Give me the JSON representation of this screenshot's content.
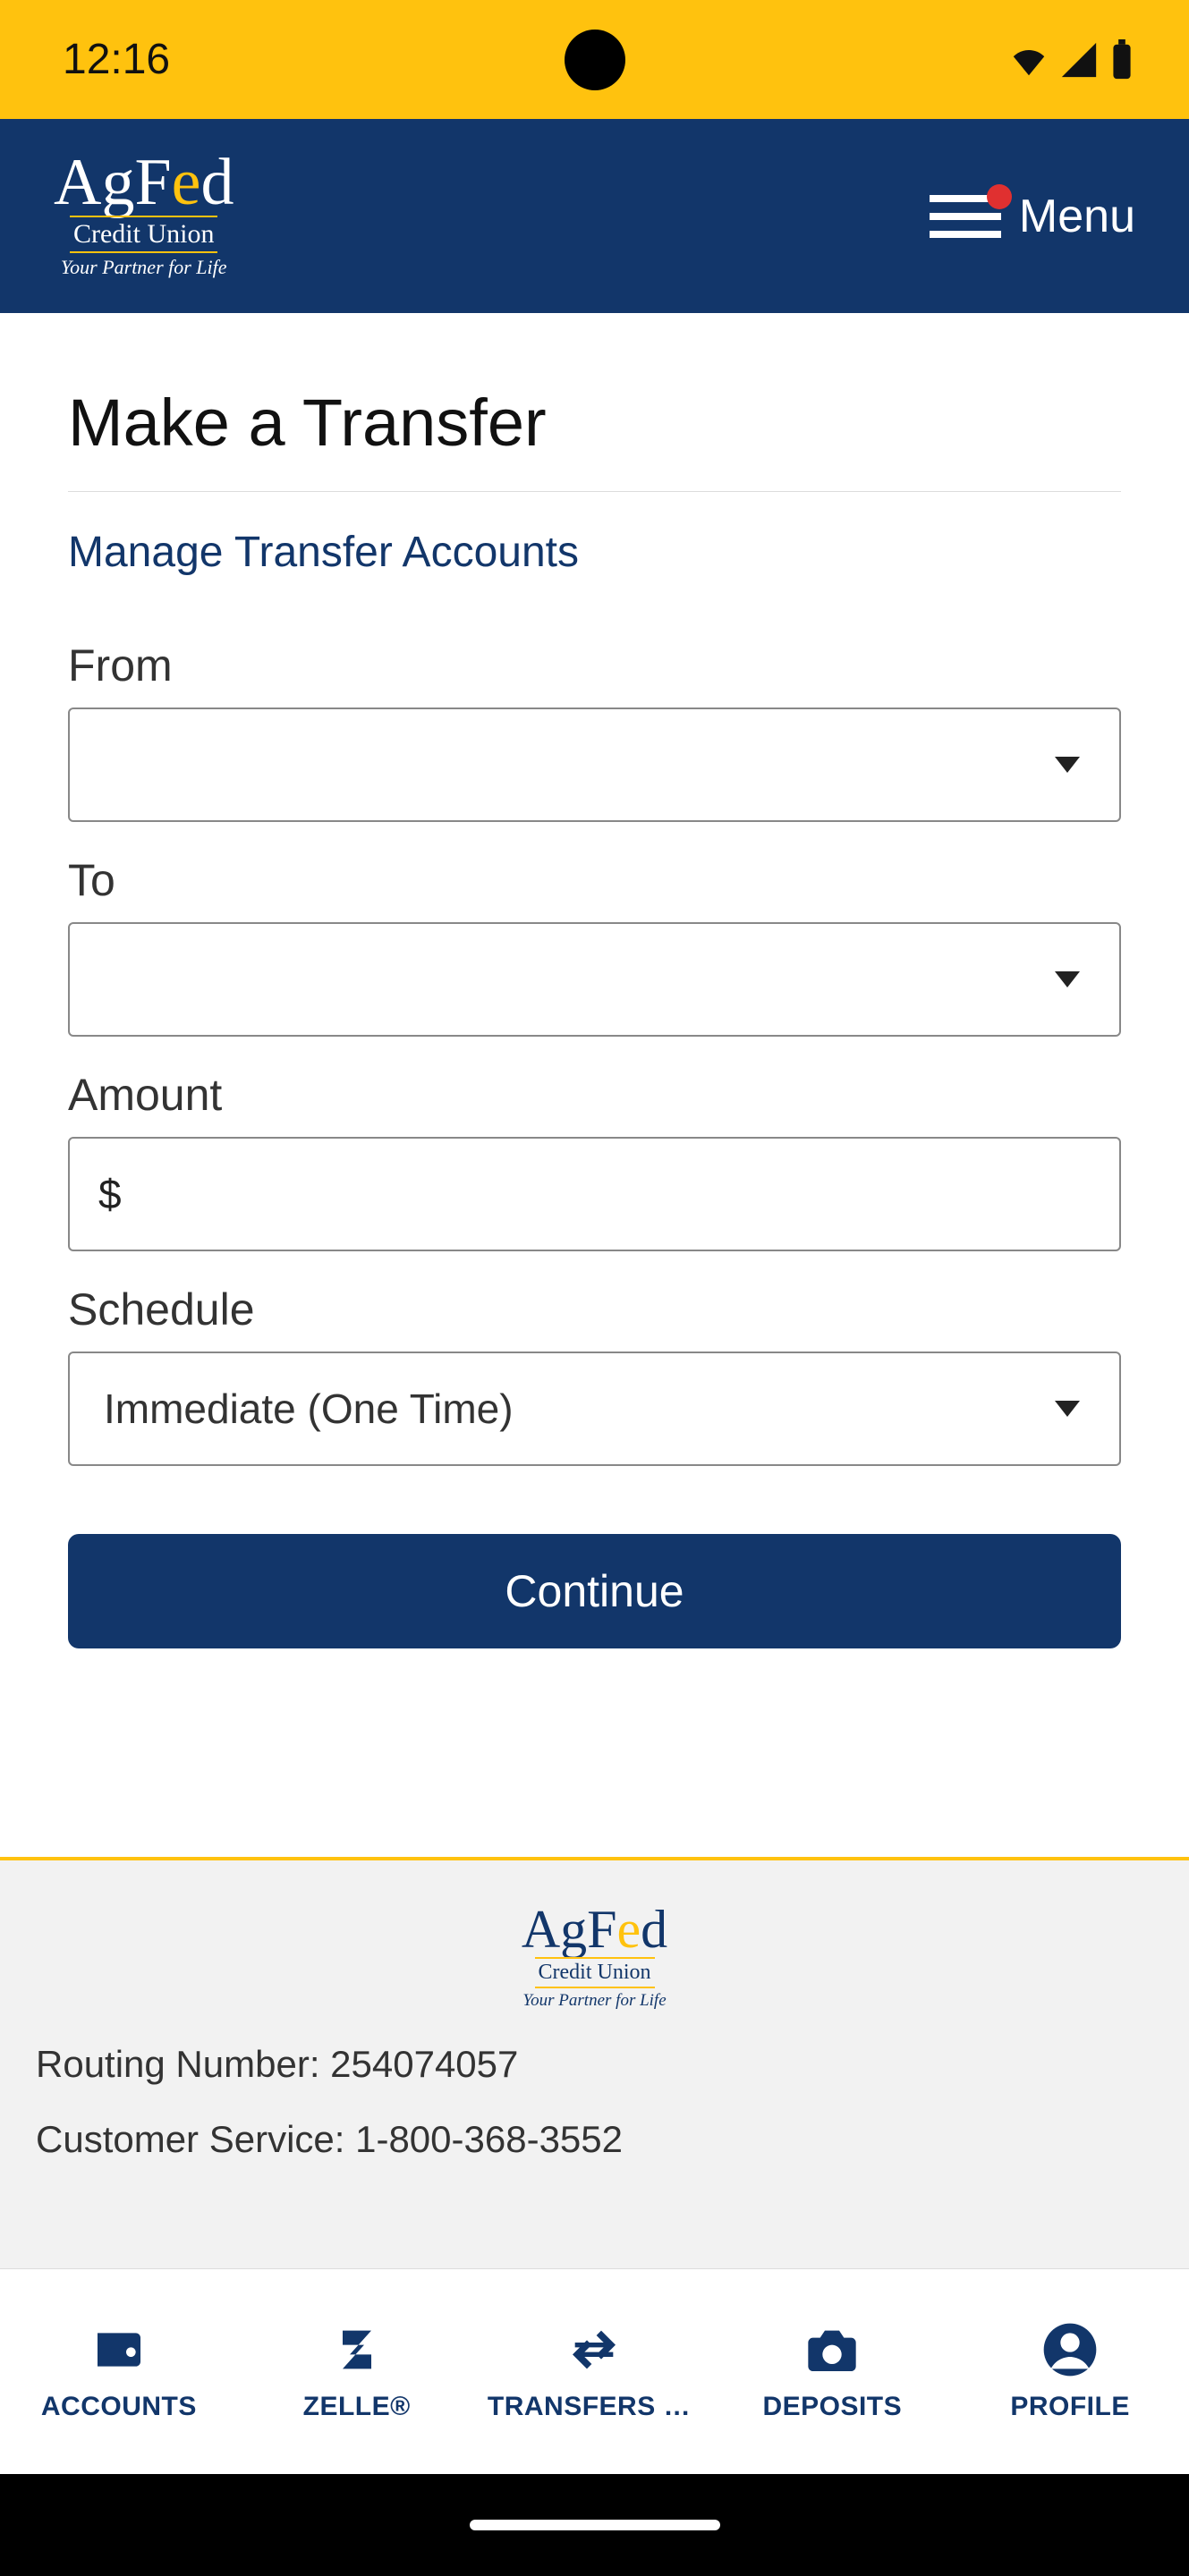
{
  "status": {
    "time": "12:16"
  },
  "header": {
    "logo_main": "AgFed",
    "logo_sub": "Credit Union",
    "logo_tag": "Your Partner for Life",
    "menu_label": "Menu"
  },
  "page": {
    "title": "Make a Transfer",
    "manage_link": "Manage Transfer Accounts",
    "from_label": "From",
    "from_value": "",
    "to_label": "To",
    "to_value": "",
    "amount_label": "Amount",
    "amount_prefix": "$",
    "amount_value": "",
    "schedule_label": "Schedule",
    "schedule_value": "Immediate (One Time)",
    "continue_label": "Continue"
  },
  "footer": {
    "routing_label": "Routing Number: 254074057",
    "service_label": "Customer Service: 1-800-368-3552"
  },
  "nav": {
    "accounts": "ACCOUNTS",
    "zelle": "ZELLE®",
    "transfers": "TRANSFERS & …",
    "deposits": "DEPOSITS",
    "profile": "PROFILE"
  }
}
